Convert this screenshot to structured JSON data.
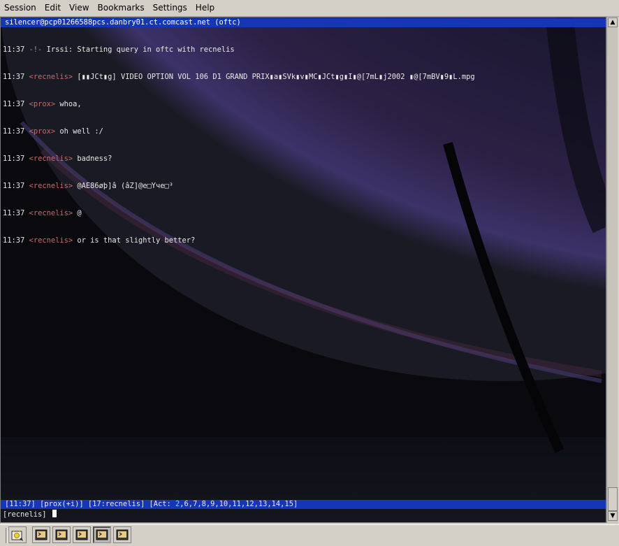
{
  "menubar": {
    "items": [
      "Session",
      "Edit",
      "View",
      "Bookmarks",
      "Settings",
      "Help"
    ]
  },
  "terminal": {
    "title": "silencer@pcp01266588pcs.danbry01.ct.comcast.net (oftc)",
    "lines": [
      {
        "time": "11:37",
        "prefix": "-!-",
        "nick": "",
        "text": "Irssi: Starting query in oftc with recnelis"
      },
      {
        "time": "11:37",
        "prefix": "",
        "nick": "recnelis",
        "text": "[▮▮JCt▮g] VIDEO OPTION VOL 106 D1 GRAND PRIX▮a▮SVk▮v▮MC▮JCt▮g▮I▮@[7mL▮j2002 ▮@[7mBV▮9▮L.mpg"
      },
      {
        "time": "11:37",
        "prefix": "",
        "nick": "prox",
        "text": "whoa,"
      },
      {
        "time": "11:37",
        "prefix": "",
        "nick": "prox",
        "text": "oh well :/"
      },
      {
        "time": "11:37",
        "prefix": "",
        "nick": "recnelis",
        "text": "badness?"
      },
      {
        "time": "11:37",
        "prefix": "",
        "nick": "recnelis",
        "text": "@AE86øþ]â (âZ]@e□Yчe□³"
      },
      {
        "time": "11:37",
        "prefix": "",
        "nick": "recnelis",
        "text": "@"
      },
      {
        "time": "11:37",
        "prefix": "",
        "nick": "recnelis",
        "text": "or is that slightly better?"
      }
    ],
    "status": {
      "time": "[11:37]",
      "window": "[prox(+i)]",
      "query": "[17:recnelis]",
      "act_label": "[Act: ",
      "act_first": "2",
      "act_rest": ",6,7,8,9,10,11,12,13,14,15]"
    },
    "input": {
      "prompt": "[recnelis]",
      "value": ""
    }
  },
  "scrollbar": {
    "up_icon": "arrow-up",
    "down_icon": "arrow-down"
  },
  "tabbar": {
    "new_session_icon": "new-session-icon",
    "tabs": [
      "terminal-tab-1",
      "terminal-tab-2",
      "terminal-tab-3",
      "terminal-tab-4",
      "terminal-tab-5"
    ],
    "active_tab_index": 3
  },
  "colors": {
    "status_blue": "#1636b8",
    "nick_red": "#c76a6a",
    "background": "#0b0b10"
  }
}
